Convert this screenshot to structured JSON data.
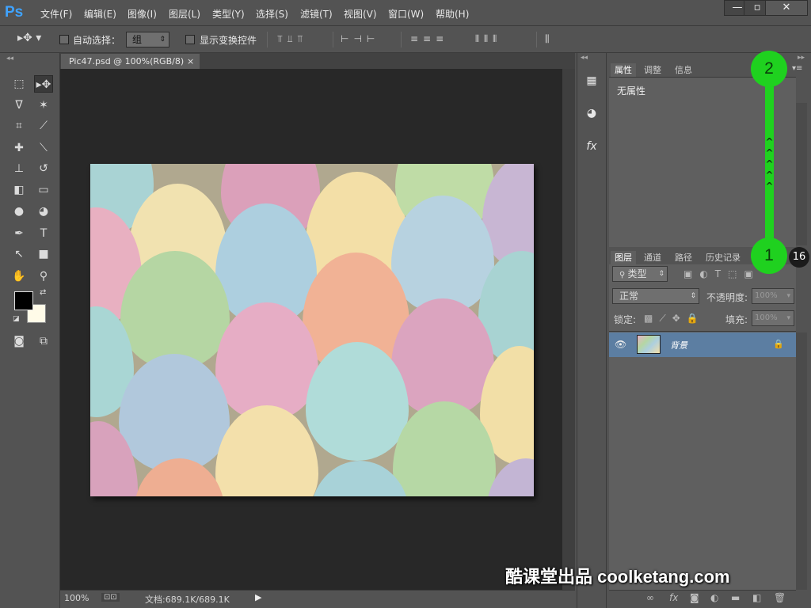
{
  "app": {
    "logo": "Ps"
  },
  "menu": [
    "文件(F)",
    "编辑(E)",
    "图像(I)",
    "图层(L)",
    "类型(Y)",
    "选择(S)",
    "滤镜(T)",
    "视图(V)",
    "窗口(W)",
    "帮助(H)"
  ],
  "window_controls": {
    "minimize": "—",
    "maximize": "▫",
    "close": "✕"
  },
  "options": {
    "auto_select_label": "自动选择：",
    "auto_select_value": "组",
    "show_transform_label": "显示变换控件"
  },
  "document": {
    "tab_title": "Pic47.psd @ 100%(RGB/8)",
    "tab_close": "×"
  },
  "status": {
    "zoom": "100%",
    "doc_info": "文档:689.1K/689.1K"
  },
  "properties_panel": {
    "tabs": [
      "属性",
      "调整",
      "信息"
    ],
    "active_tab": 0,
    "body_text": "无属性"
  },
  "layers_panel": {
    "tabs": [
      "图层",
      "通道",
      "路径",
      "历史记录"
    ],
    "active_tab": 0,
    "filter_label": "类型",
    "blend_mode": "正常",
    "opacity_label": "不透明度:",
    "opacity_value": "100%",
    "lock_label": "锁定:",
    "fill_label": "填充:",
    "fill_value": "100%",
    "layers": [
      {
        "name": "背景",
        "visible": true,
        "locked": true
      }
    ]
  },
  "annotations": {
    "marker_top": "2",
    "marker_bottom": "1",
    "badge": "16"
  },
  "watermark": "酷课堂出品 coolketang.com",
  "colors": {
    "accent": "#3fa3ff",
    "highlight_green": "#1fd11f",
    "layer_selected": "#5c7ea2"
  }
}
